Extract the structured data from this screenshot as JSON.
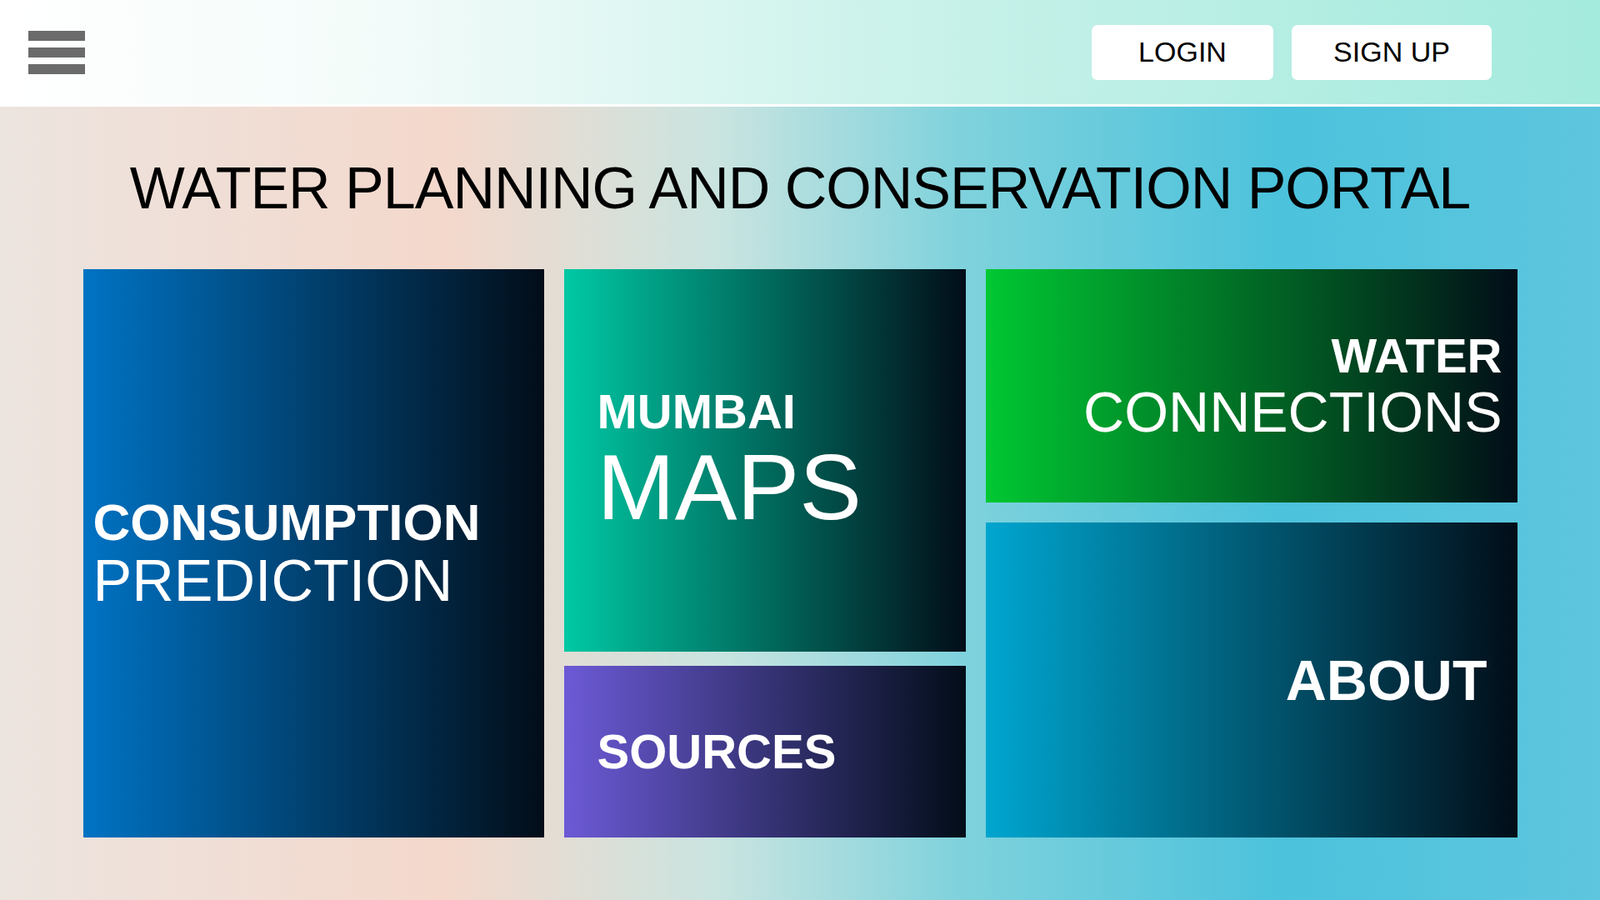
{
  "header": {
    "buttons": [
      "LOGIN",
      "SIGN UP"
    ]
  },
  "title": "WATER PLANNING AND CONSERVATION PORTAL",
  "tiles": [
    {
      "title": "CONSUMPTION",
      "subtitle": "PREDICTION",
      "color": "#0073c4"
    },
    {
      "title": "MUMBAI",
      "subtitle": "MAPS",
      "color": "#00c9a4"
    },
    {
      "title": "SOURCES",
      "color": "#6c5ad6"
    },
    {
      "title": "WATER",
      "subtitle": "CONNECTIONS",
      "color": "#00c832"
    },
    {
      "title": "ABOUT",
      "color": "#00a6d0"
    }
  ]
}
